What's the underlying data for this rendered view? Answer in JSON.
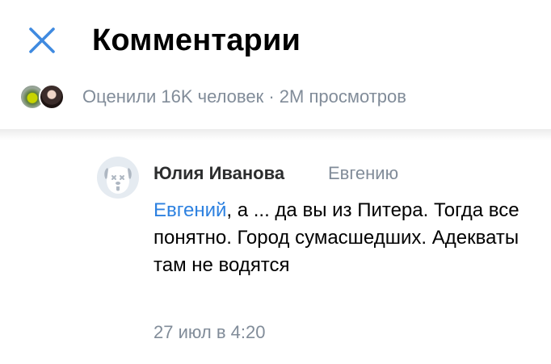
{
  "header": {
    "title": "Комментарии",
    "close_icon": "close-icon"
  },
  "likes": {
    "text": "Оценили 16K человек · 2M просмотров",
    "avatars": [
      "liker-avatar-1",
      "liker-avatar-2"
    ]
  },
  "comment": {
    "author": "Юлия Иванова",
    "reply_to": "Евгению",
    "mention": "Евгений",
    "text": ", а ... да вы из Питера. Тогда все понятно. Город сумасшедших. Адекваты там не водятся",
    "date": "27 июл в 4:20",
    "avatar_icon": "deactivated-dog-icon"
  },
  "colors": {
    "accent": "#3f8ae0",
    "mention": "#2d81e0",
    "secondary_text": "#818c99",
    "avatar_bg": "#e5ebf1",
    "avatar_dog": "#aeb7c2"
  }
}
